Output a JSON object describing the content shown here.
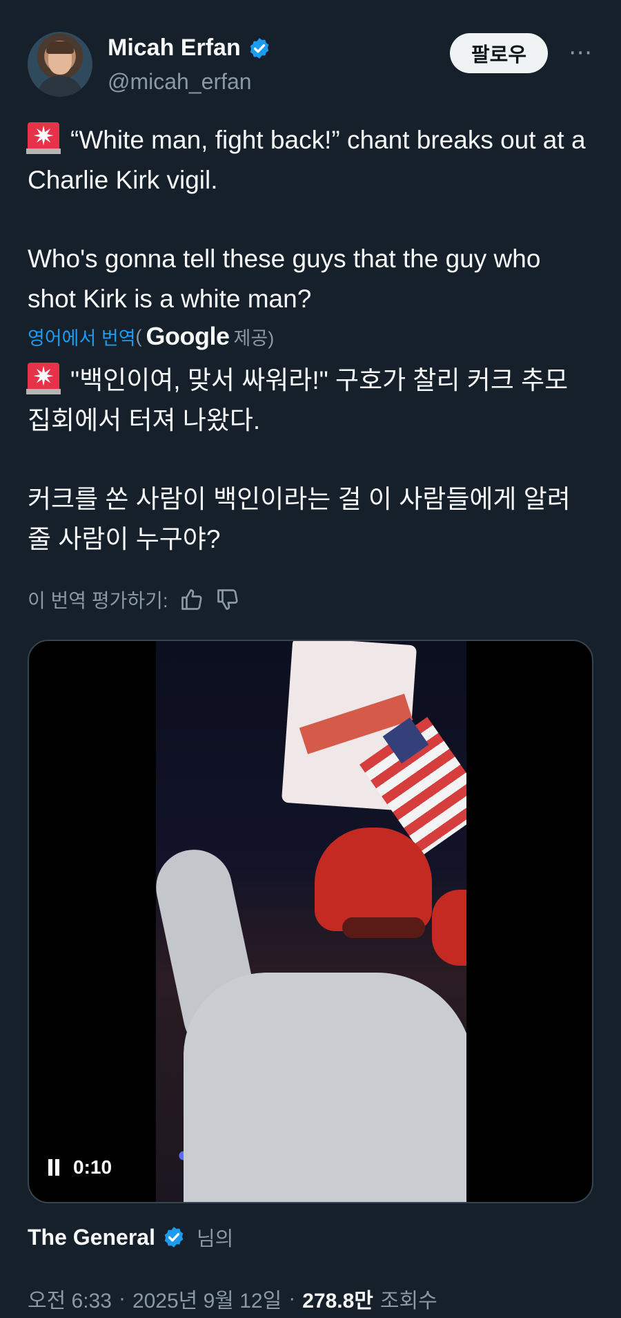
{
  "author": {
    "name": "Micah Erfan",
    "handle": "@micah_erfan"
  },
  "follow_label": "팔로우",
  "more_icon": "⋯",
  "tweet": {
    "original_line1": "“White man, fight back!” chant breaks out at a Charlie Kirk vigil.",
    "original_line2": "Who's gonna tell these guys that the guy who shot Kirk is a white man?",
    "translate_link": "영어에서 번역",
    "translate_provider_prefix": "(",
    "translate_provider": "Google",
    "translate_provider_suffix": "제공)",
    "translated_line1": "\"백인이여, 맞서 싸워라!\" 구호가 찰리 커크 추모 집회에서 터져 나왔다.",
    "translated_line2": "커크를 쏜 사람이 백인이라는 걸 이 사람들에게 알려줄 사람이 누구야?",
    "rate_label": "이 번역 평가하기:"
  },
  "video": {
    "time": "0:10"
  },
  "source": {
    "name": "The General",
    "suffix": "님의"
  },
  "meta": {
    "time": "오전 6:33",
    "date": "2025년 9월 12일",
    "views": "278.8만",
    "views_label": "조회수"
  },
  "colors": {
    "background": "#15202b",
    "verified": "#1d9bf0",
    "link": "#1d9bf0"
  }
}
